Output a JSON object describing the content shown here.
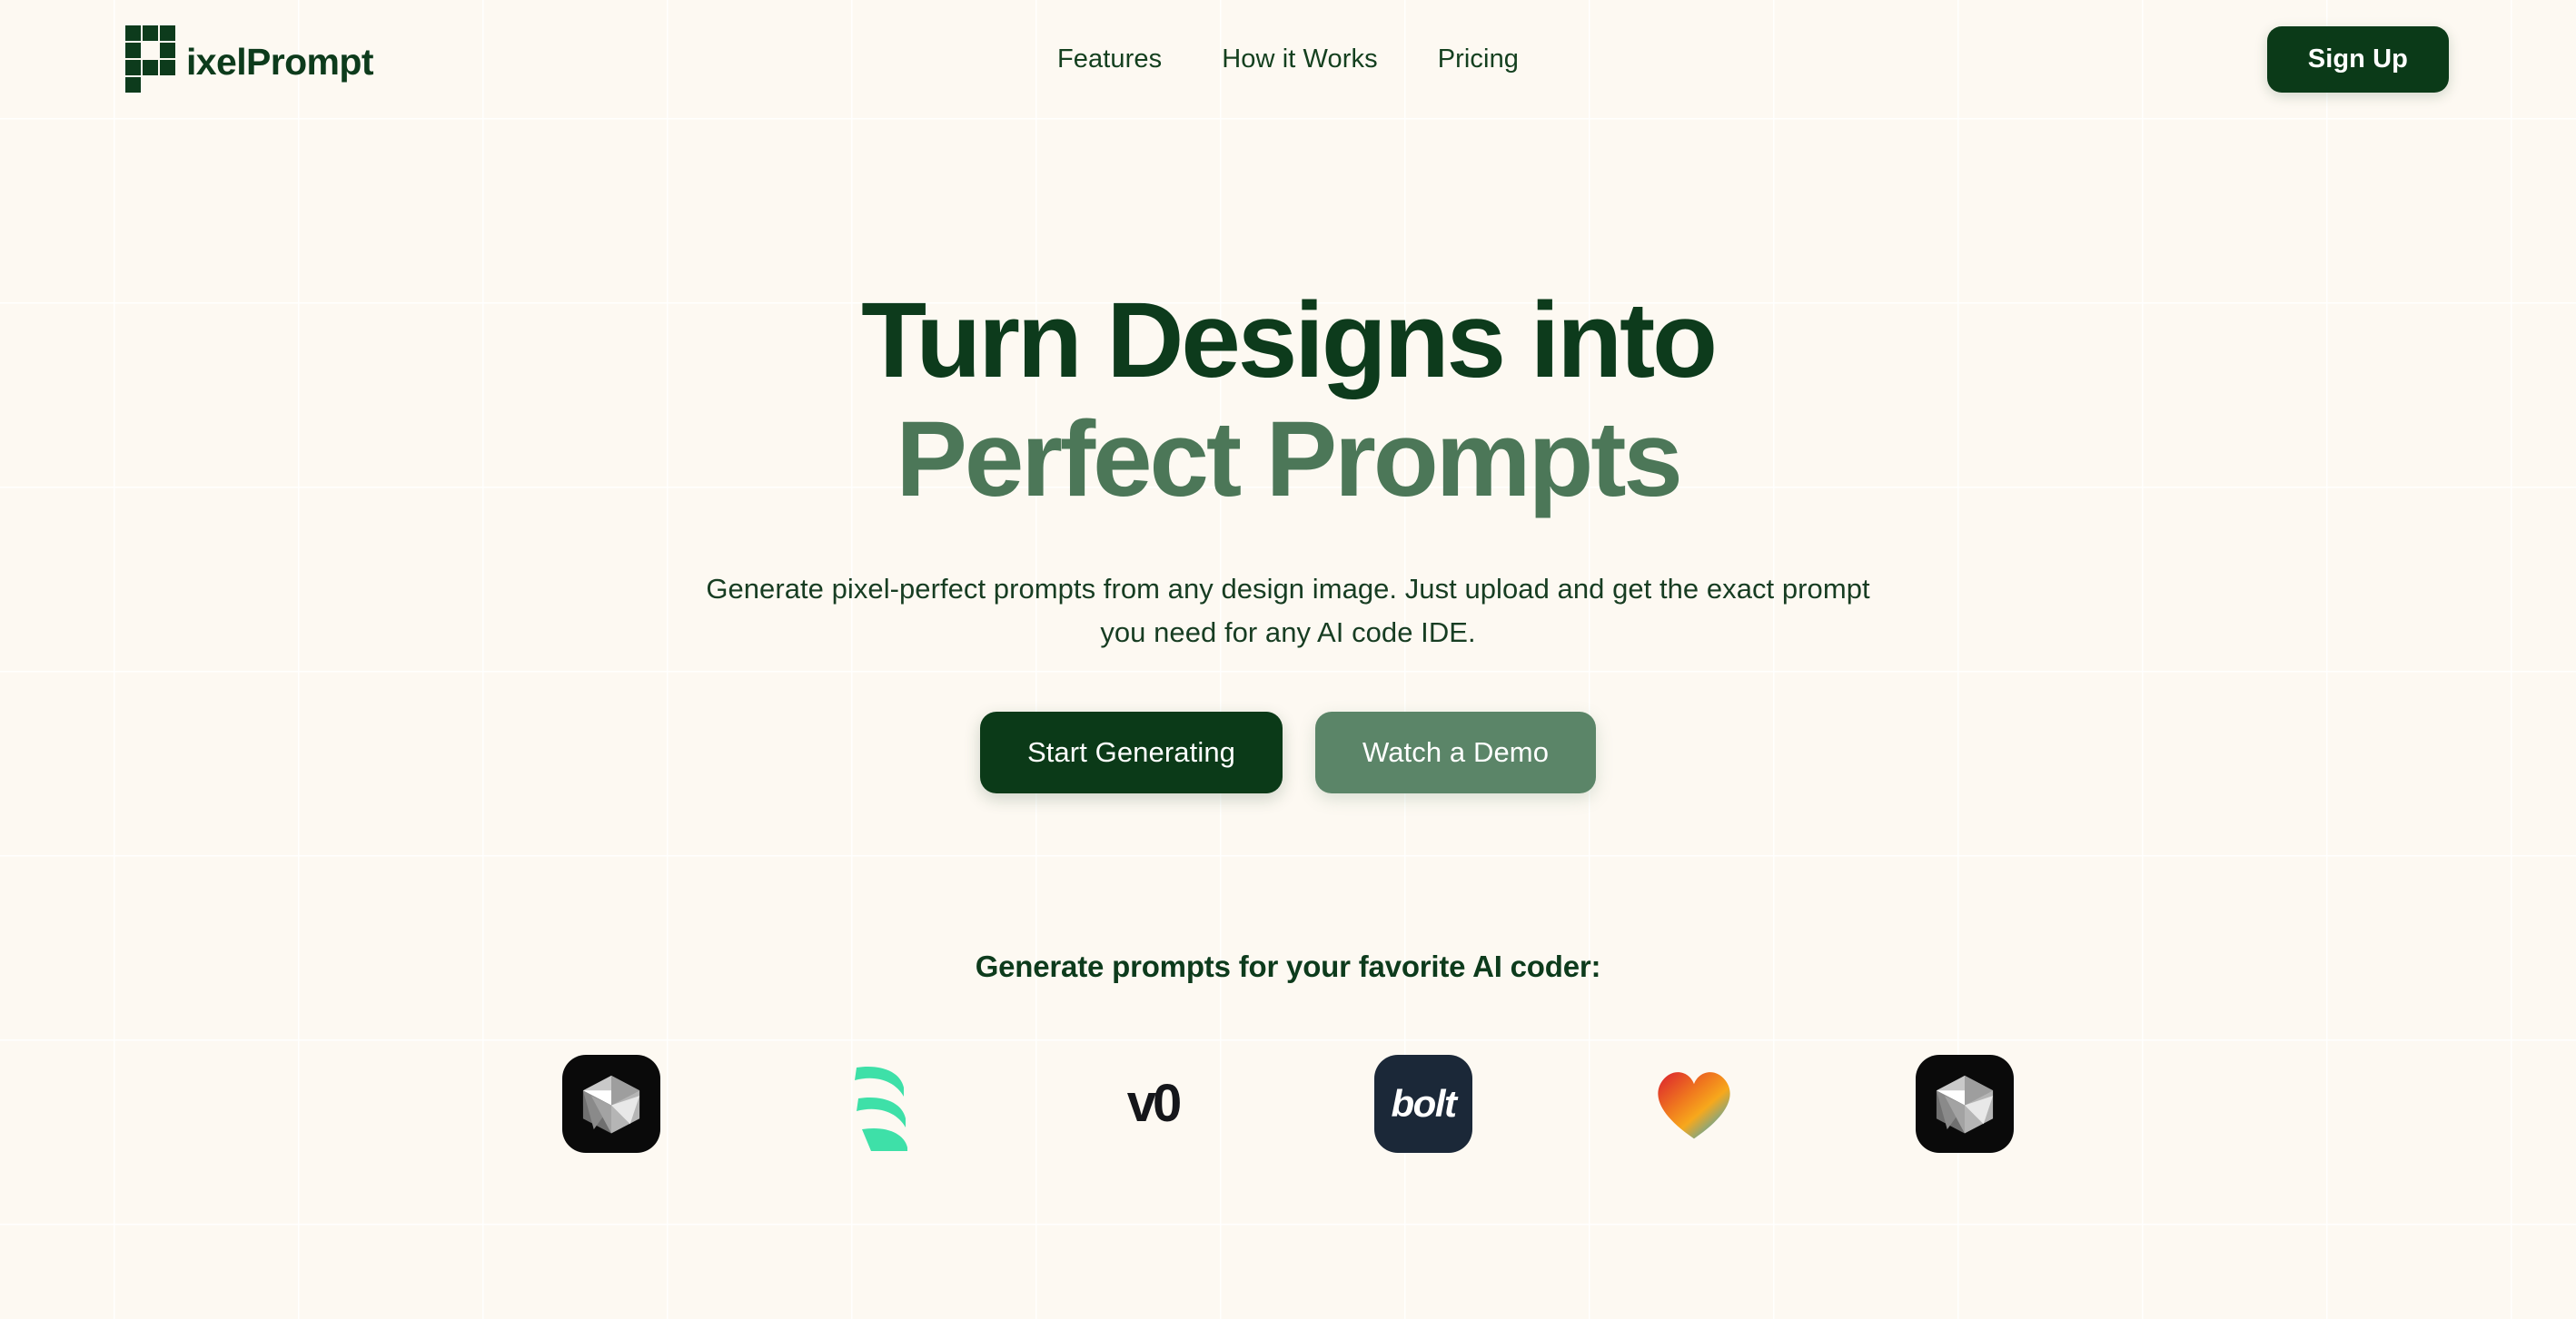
{
  "theme": {
    "background": "#FDF9F2",
    "grid_line": "#FFFFFF",
    "dark_green": "#0D3B1C",
    "mid_green": "#4C7758",
    "sage_green": "#5B8568",
    "text_green": "#173D22"
  },
  "header": {
    "brand_name": "ixelPrompt",
    "logo_icon": "pixel-p-logo",
    "nav": [
      {
        "label": "Features"
      },
      {
        "label": "How it Works"
      },
      {
        "label": "Pricing"
      }
    ],
    "signup_label": "Sign Up"
  },
  "hero": {
    "headline_line_1": "Turn Designs into",
    "headline_line_2": "Perfect Prompts",
    "subtitle_line_1": "Generate pixel-perfect prompts from any design image. Just upload and get the exact prompt",
    "subtitle_line_2": "you need for any AI code IDE.",
    "cta_primary": "Start Generating",
    "cta_secondary": "Watch a Demo"
  },
  "partners": {
    "title": "Generate prompts for your favorite AI coder:",
    "logos": [
      {
        "name": "cube-tile-logo",
        "style": "cube-tile",
        "text": ""
      },
      {
        "name": "wave-stack-logo",
        "style": "wave",
        "text": ""
      },
      {
        "name": "v0-logo",
        "style": "wordmark-v0",
        "text": "v0"
      },
      {
        "name": "bolt-logo",
        "style": "wordmark-bolt",
        "text": "bolt"
      },
      {
        "name": "gradient-heart-logo",
        "style": "heart",
        "text": ""
      },
      {
        "name": "cube-tile-logo-2",
        "style": "cube-tile",
        "text": ""
      }
    ]
  }
}
